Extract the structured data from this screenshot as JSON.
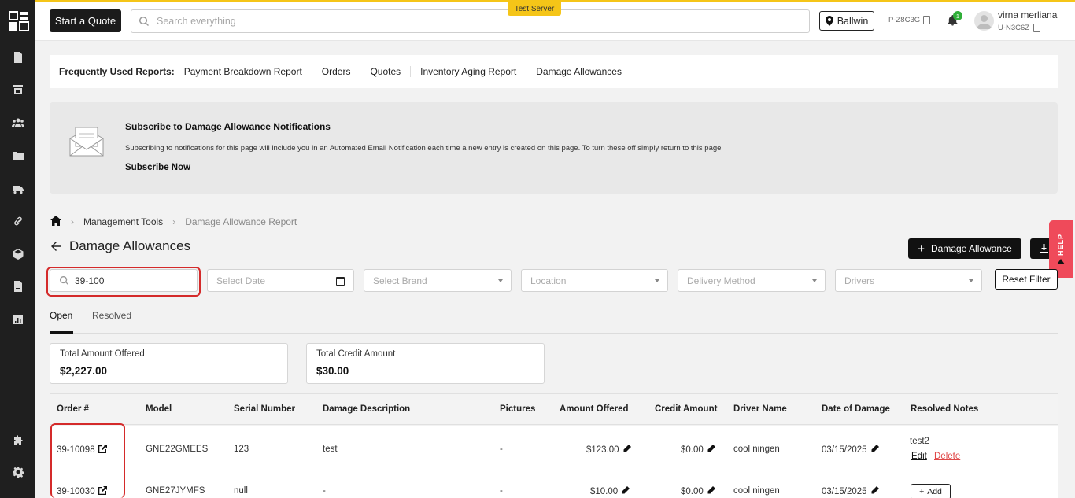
{
  "header": {
    "start_quote": "Start a Quote",
    "search_placeholder": "Search everything",
    "test_server": "Test Server",
    "location": "Ballwin",
    "p_code": "P-Z8C3G",
    "notif_count": "1",
    "user_name": "virna merliana",
    "user_code": "U-N3C6Z"
  },
  "reports": {
    "label": "Frequently Used Reports:",
    "links": [
      "Payment Breakdown Report",
      "Orders",
      "Quotes",
      "Inventory Aging Report",
      "Damage Allowances"
    ]
  },
  "subscribe": {
    "title": "Subscribe to Damage Allowance Notifications",
    "text": "Subscribing to notifications for this page will include you in an Automated Email Notification each time a new entry is created on this page. To turn these off simply return to this page",
    "action": "Subscribe Now"
  },
  "breadcrumb": {
    "level1": "Management Tools",
    "level2": "Damage Allowance Report"
  },
  "page": {
    "title": "Damage Allowances",
    "add_button": "Damage Allowance",
    "help": "HELP"
  },
  "filters": {
    "search_value": "39-100",
    "date_placeholder": "Select Date",
    "brand_placeholder": "Select Brand",
    "location_placeholder": "Location",
    "delivery_placeholder": "Delivery Method",
    "drivers_placeholder": "Drivers",
    "reset": "Reset Filter"
  },
  "tabs": {
    "open": "Open",
    "resolved": "Resolved"
  },
  "summary": {
    "offered_label": "Total Amount Offered",
    "offered_value": "$2,227.00",
    "credit_label": "Total Credit Amount",
    "credit_value": "$30.00"
  },
  "table": {
    "columns": [
      "Order #",
      "Model",
      "Serial Number",
      "Damage Description",
      "Pictures",
      "Amount Offered",
      "Credit Amount",
      "Driver Name",
      "Date of Damage",
      "Resolved Notes"
    ],
    "rows": [
      {
        "order": "39-10098",
        "model": "GNE22GMEES",
        "serial": "123",
        "description": "test",
        "pictures": "-",
        "offered": "$123.00",
        "credit": "$0.00",
        "driver": "cool ningen",
        "date": "03/15/2025",
        "notes": "test2",
        "edit": "Edit",
        "delete": "Delete"
      },
      {
        "order": "39-10030",
        "model": "GNE27JYMFS",
        "serial": "null",
        "description": "-",
        "pictures": "-",
        "offered": "$10.00",
        "credit": "$0.00",
        "driver": "cool ningen",
        "date": "03/15/2025",
        "add": "Add"
      }
    ]
  }
}
